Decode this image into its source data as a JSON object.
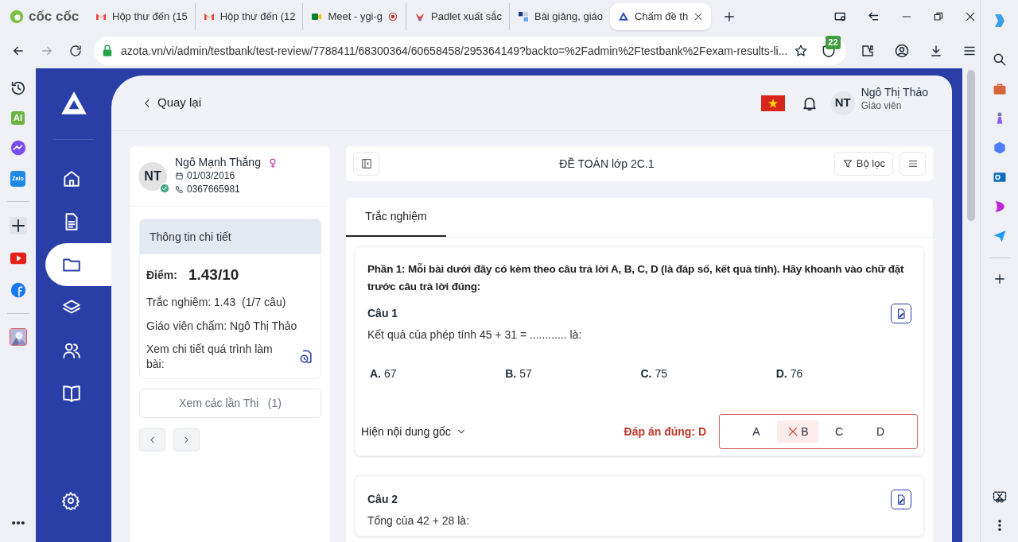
{
  "browser": {
    "brand": "cốc cốc",
    "tabs": [
      {
        "title": "Hộp thư đến (15",
        "kind": "gmail",
        "selected": false
      },
      {
        "title": "Hộp thư đến (12",
        "kind": "gmail",
        "selected": false
      },
      {
        "title": "Meet - ygi-g",
        "kind": "meet",
        "selected": false
      },
      {
        "title": "Padlet xuất sắc",
        "kind": "padlet",
        "selected": false
      },
      {
        "title": "Bài giảng, giáo",
        "kind": "doc",
        "selected": false
      },
      {
        "title": "Chấm đề th",
        "kind": "azota",
        "selected": true
      }
    ],
    "address": "azota.vn/vi/admin/testbank/test-review/7788411/68300364/60658458/295364149?backto=%2Fadmin%2Ftestbank%2Fexam-results-li...",
    "extension_badge": "22",
    "sidebar_labels": [
      "AI",
      "Zalo"
    ]
  },
  "header": {
    "back": "Quay lại",
    "user_initials": "NT",
    "user_name": "Ngô Thị Thảo",
    "user_role": "Giáo viên"
  },
  "nav": [
    {
      "kind": "home",
      "selected": false
    },
    {
      "kind": "document",
      "selected": false
    },
    {
      "kind": "folder",
      "selected": true
    },
    {
      "kind": "layers",
      "selected": false
    },
    {
      "kind": "users",
      "selected": false
    },
    {
      "kind": "book",
      "selected": false
    }
  ],
  "student": {
    "initials": "NT",
    "name": "Ngô Mạnh Thắng",
    "birthday": "01/03/2016",
    "phone": "0367665981"
  },
  "details": {
    "title": "Thông tin chi tiết",
    "score_label": "Điểm:",
    "score": "1.43/10",
    "lines": [
      "Trắc nghiệm: 1.43  (1/7 câu)",
      "Giáo viên chấm: Ngô Thị Thảo"
    ],
    "process": "Xem chi tiết quá trình làm bài:"
  },
  "attempts_button": "Xem các lần Thi   (1)",
  "toolbar": {
    "title": "ĐỀ TOÁN lớp 2C.1",
    "filter": "Bộ lọc"
  },
  "tabs": [
    {
      "label": "Trắc nghiệm",
      "selected": true
    }
  ],
  "section": "Phần 1: Mỗi bài dưới đây có kèm theo câu trả lời A, B, C, D (là đáp số, kết quả tính). Hãy khoanh vào chữ đặt trước câu trả lời đúng:",
  "questions": [
    {
      "title": "Câu 1",
      "text": "Kết quả của phép tính 45 + 31 = ............ là:",
      "options": [
        {
          "letter": "A.",
          "text": "67"
        },
        {
          "letter": "B.",
          "text": "57"
        },
        {
          "letter": "C.",
          "text": "75"
        },
        {
          "letter": "D.",
          "text": "76"
        }
      ],
      "show_original": "Hiện nội dung gốc",
      "correct": "Đáp án đúng: D",
      "choices": [
        {
          "label": "A",
          "selected": false
        },
        {
          "label": "B",
          "selected": true
        },
        {
          "label": "C",
          "selected": false
        },
        {
          "label": "D",
          "selected": false
        }
      ]
    },
    {
      "title": "Câu 2",
      "text": "Tổng của 42 + 28 là:"
    }
  ]
}
